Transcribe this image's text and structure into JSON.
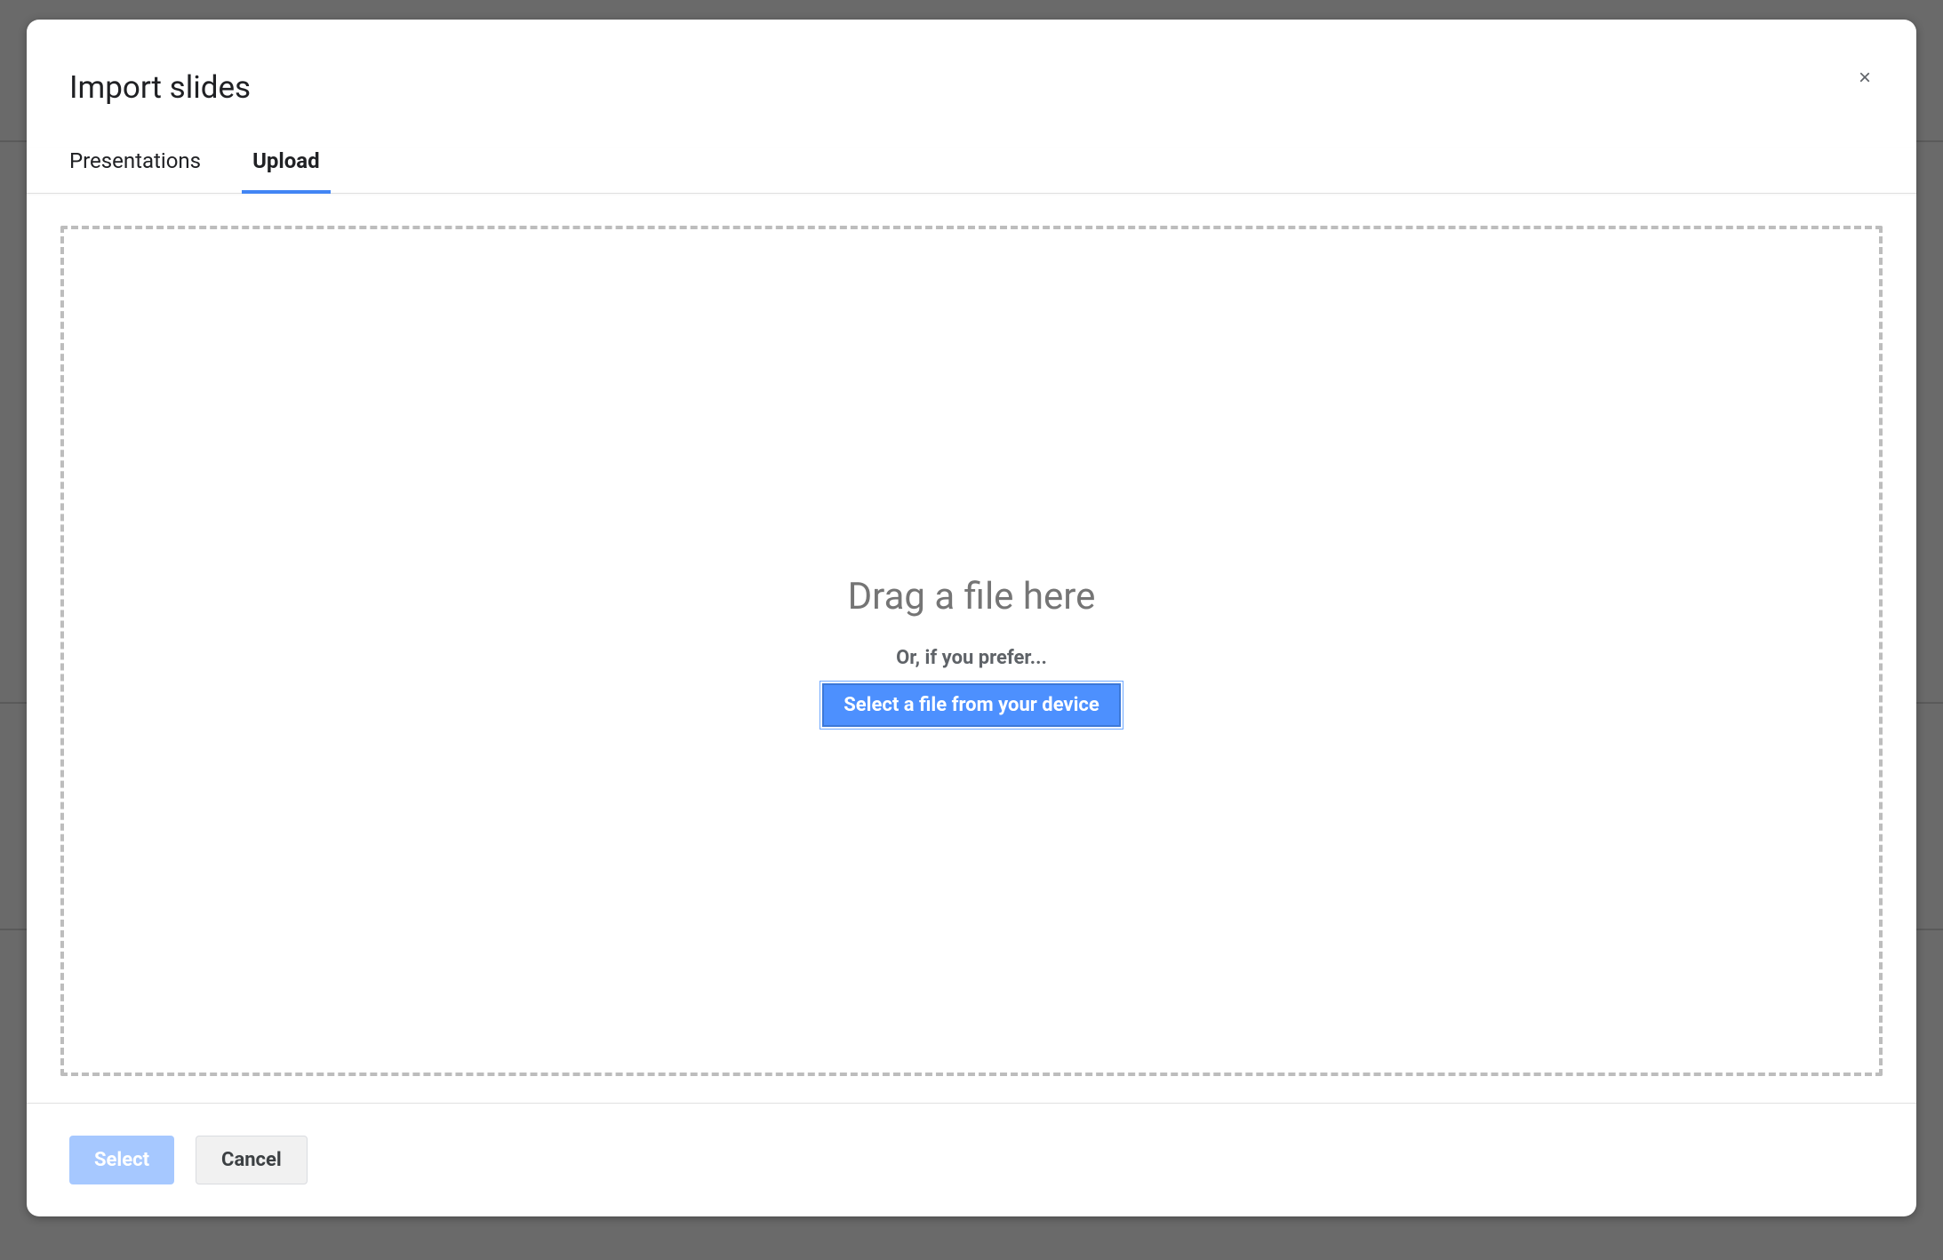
{
  "dialog": {
    "title": "Import slides",
    "close_label": "×"
  },
  "tabs": {
    "presentations": "Presentations",
    "upload": "Upload"
  },
  "dropzone": {
    "drag_text": "Drag a file here",
    "prefer_text": "Or, if you prefer...",
    "button_label": "Select a file from your device"
  },
  "footer": {
    "select_label": "Select",
    "cancel_label": "Cancel"
  }
}
